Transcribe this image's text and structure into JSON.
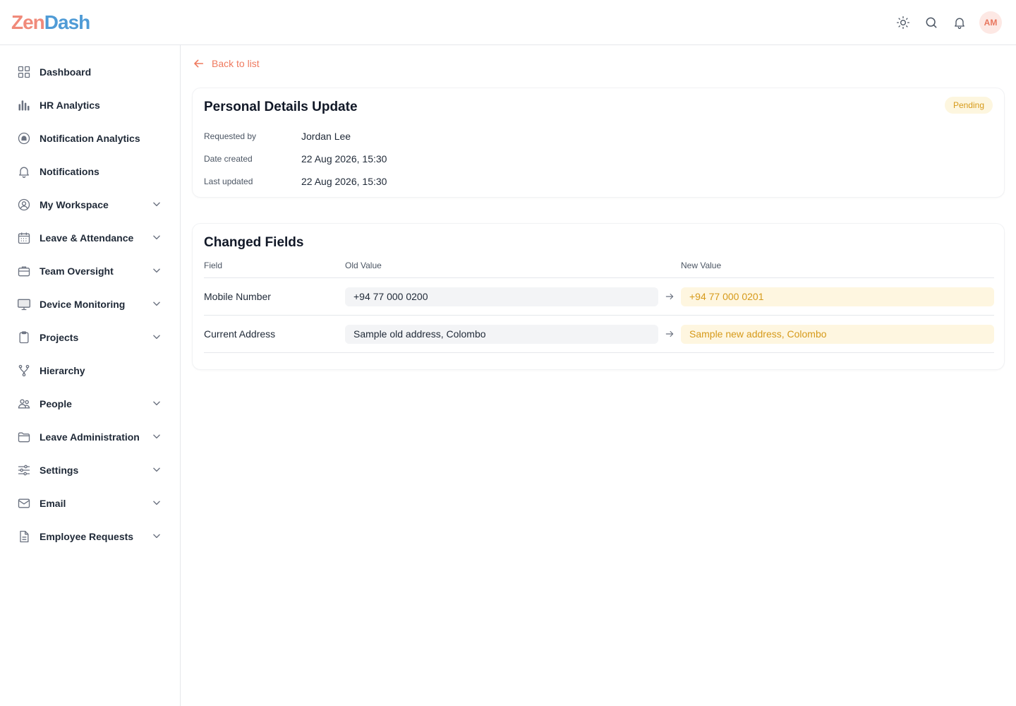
{
  "app": {
    "logo_part1": "Zen",
    "logo_part2": "Dash"
  },
  "header": {
    "avatar_initials": "AM"
  },
  "sidebar": {
    "items": [
      {
        "label": "Dashboard",
        "icon": "grid-icon",
        "expandable": false
      },
      {
        "label": "HR Analytics",
        "icon": "bar-chart-icon",
        "expandable": false
      },
      {
        "label": "Notification Analytics",
        "icon": "bell-circle-icon",
        "expandable": false
      },
      {
        "label": "Notifications",
        "icon": "bell-icon",
        "expandable": false
      },
      {
        "label": "My Workspace",
        "icon": "user-circle-icon",
        "expandable": true
      },
      {
        "label": "Leave & Attendance",
        "icon": "calendar-icon",
        "expandable": true
      },
      {
        "label": "Team Oversight",
        "icon": "briefcase-icon",
        "expandable": true
      },
      {
        "label": "Device Monitoring",
        "icon": "monitor-icon",
        "expandable": true
      },
      {
        "label": "Projects",
        "icon": "clipboard-icon",
        "expandable": true
      },
      {
        "label": "Hierarchy",
        "icon": "hierarchy-icon",
        "expandable": false
      },
      {
        "label": "People",
        "icon": "people-icon",
        "expandable": true
      },
      {
        "label": "Leave Administration",
        "icon": "folder-icon",
        "expandable": true
      },
      {
        "label": "Settings",
        "icon": "sliders-icon",
        "expandable": true
      },
      {
        "label": "Email",
        "icon": "mail-icon",
        "expandable": true
      },
      {
        "label": "Employee Requests",
        "icon": "document-icon",
        "expandable": true
      }
    ]
  },
  "main": {
    "back_label": "Back to list",
    "details": {
      "title": "Personal Details Update",
      "status": "Pending",
      "requested_by_label": "Requested by",
      "requested_by": "Jordan Lee",
      "date_created_label": "Date created",
      "date_created": "22 Aug 2026, 15:30",
      "last_updated_label": "Last updated",
      "last_updated": "22 Aug 2026, 15:30"
    },
    "changes": {
      "title": "Changed Fields",
      "columns": {
        "field": "Field",
        "old": "Old Value",
        "new": "New Value"
      },
      "rows": [
        {
          "field": "Mobile Number",
          "old": "+94 77 000 0200",
          "new": "+94 77 000 0201"
        },
        {
          "field": "Current Address",
          "old": "Sample old address, Colombo",
          "new": "Sample new address, Colombo"
        }
      ]
    }
  },
  "colors": {
    "accent": "#ef7a5f",
    "pending": "#d69a1a",
    "pending_bg": "#fdf6df"
  }
}
